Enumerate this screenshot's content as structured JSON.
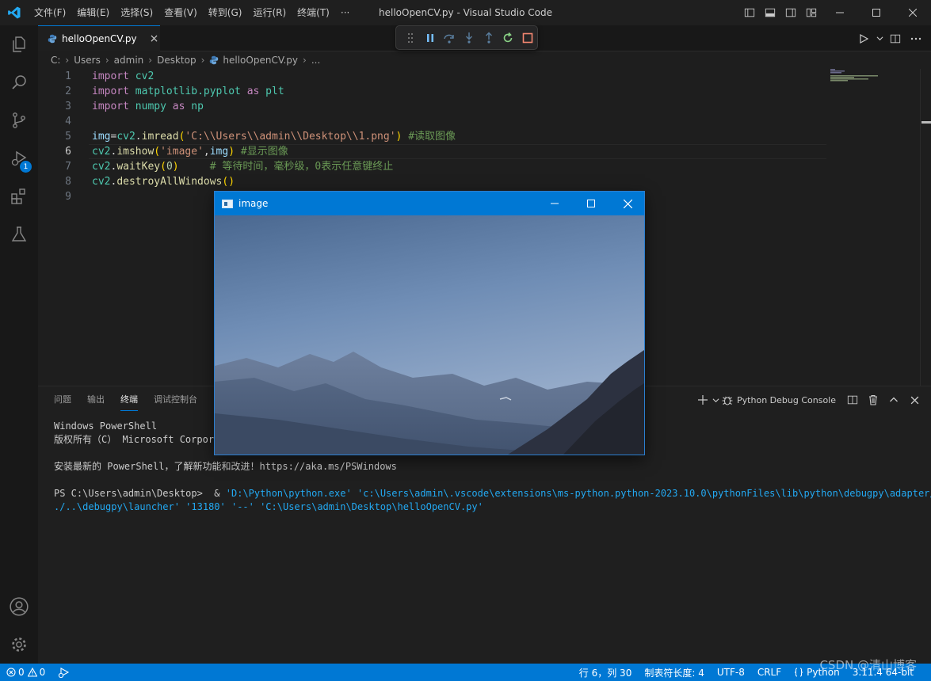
{
  "titlebar": {
    "menu": [
      "文件(F)",
      "编辑(E)",
      "选择(S)",
      "查看(V)",
      "转到(G)",
      "运行(R)",
      "终端(T)",
      "···"
    ],
    "window_title": "helloOpenCV.py - Visual Studio Code"
  },
  "tab": {
    "label": "helloOpenCV.py",
    "close": "×"
  },
  "breadcrumb": [
    "C:",
    "Users",
    "admin",
    "Desktop",
    "helloOpenCV.py",
    "..."
  ],
  "editor": {
    "line_numbers": [
      "1",
      "2",
      "3",
      "4",
      "5",
      "6",
      "7",
      "8",
      "9"
    ],
    "active_line": 6,
    "lines": [
      [
        {
          "t": "import",
          "c": "kw"
        },
        {
          "t": " "
        },
        {
          "t": "cv2",
          "c": "mod"
        }
      ],
      [
        {
          "t": "import",
          "c": "kw"
        },
        {
          "t": " "
        },
        {
          "t": "matplotlib.pyplot",
          "c": "mod"
        },
        {
          "t": " "
        },
        {
          "t": "as",
          "c": "kw"
        },
        {
          "t": " "
        },
        {
          "t": "plt",
          "c": "mod"
        }
      ],
      [
        {
          "t": "import",
          "c": "kw"
        },
        {
          "t": " "
        },
        {
          "t": "numpy",
          "c": "mod"
        },
        {
          "t": " "
        },
        {
          "t": "as",
          "c": "kw"
        },
        {
          "t": " "
        },
        {
          "t": "np",
          "c": "mod"
        }
      ],
      [],
      [
        {
          "t": "img",
          "c": "var"
        },
        {
          "t": "=",
          "c": "op"
        },
        {
          "t": "cv2",
          "c": "mod"
        },
        {
          "t": ".",
          "c": "op"
        },
        {
          "t": "imread",
          "c": "fn"
        },
        {
          "t": "(",
          "c": "br1"
        },
        {
          "t": "'C:\\\\Users\\\\admin\\\\Desktop\\\\1.png'",
          "c": "str"
        },
        {
          "t": ")",
          "c": "br1"
        },
        {
          "t": " "
        },
        {
          "t": "#读取图像",
          "c": "cmt"
        }
      ],
      [
        {
          "t": "cv2",
          "c": "mod"
        },
        {
          "t": ".",
          "c": "op"
        },
        {
          "t": "imshow",
          "c": "fn"
        },
        {
          "t": "(",
          "c": "br1"
        },
        {
          "t": "'image'",
          "c": "str"
        },
        {
          "t": ",",
          "c": "op"
        },
        {
          "t": "img",
          "c": "var"
        },
        {
          "t": ")",
          "c": "br1"
        },
        {
          "t": " "
        },
        {
          "t": "#显示图像",
          "c": "cmt"
        }
      ],
      [
        {
          "t": "cv2",
          "c": "mod"
        },
        {
          "t": ".",
          "c": "op"
        },
        {
          "t": "waitKey",
          "c": "fn"
        },
        {
          "t": "(",
          "c": "br1"
        },
        {
          "t": "0",
          "c": "num"
        },
        {
          "t": ")",
          "c": "br1"
        },
        {
          "t": "     "
        },
        {
          "t": "# 等待时间，毫秒级，0表示任意键终止",
          "c": "cmt"
        }
      ],
      [
        {
          "t": "cv2",
          "c": "mod"
        },
        {
          "t": ".",
          "c": "op"
        },
        {
          "t": "destroyAllWindows",
          "c": "fn"
        },
        {
          "t": "()",
          "c": "br1"
        }
      ],
      []
    ]
  },
  "activity": {
    "debug_badge": "1"
  },
  "panel": {
    "tabs": [
      "问题",
      "输出",
      "终端",
      "调试控制台"
    ],
    "active_tab": "终端",
    "debug_console": "Python Debug Console",
    "terminal": {
      "line1": "Windows PowerShell",
      "line2": "版权所有（C） Microsoft Corporation。保留所有权利。",
      "line3": "安装最新的 PowerShell，了解新功能和改进！https://aka.ms/PSWindows",
      "prompt": "PS C:\\Users\\admin\\Desktop> ",
      "amp": " & ",
      "cmd_part1": "'D:\\Python\\python.exe' 'c:\\Users\\admin\\.vscode\\extensions\\ms-python.python-2023.10.0\\pythonFiles\\lib\\python\\debugpy\\adapter/.",
      "cmd_part2": "./..\\debugpy\\launcher' '13180' '--' 'C:\\Users\\admin\\Desktop\\helloOpenCV.py'"
    }
  },
  "cv_window": {
    "title": "image"
  },
  "statusbar": {
    "errors": "0",
    "warnings": "0",
    "position": "行 6，列 30",
    "tab_size": "制表符长度: 4",
    "encoding": "UTF-8",
    "eol": "CRLF",
    "language": "Python",
    "interpreter": "3.11.4 64-bit"
  },
  "watermark": "CSDN @清山博客",
  "colors": {
    "accent": "#0078d4",
    "editor_bg": "#1e1e1e"
  }
}
